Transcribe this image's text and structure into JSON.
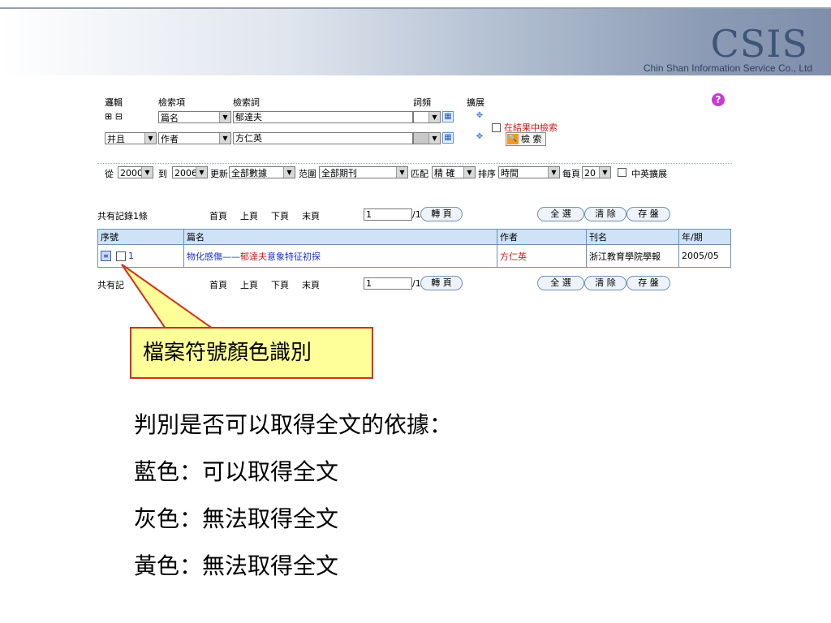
{
  "header": {
    "brand": "CSIS",
    "brand_sub": "Chin Shan Information Service Co., Ltd"
  },
  "search_form": {
    "labels": {
      "logic": "邏輯",
      "field": "檢索項",
      "term": "檢索詞",
      "freq": "詞頻",
      "expand": "擴展"
    },
    "expand_icons": "⊞ ⊟",
    "rows": [
      {
        "logic": "",
        "field": "篇名",
        "term": "郁達夫",
        "freq": ""
      },
      {
        "logic": "并且",
        "field": "作者",
        "term": "方仁英",
        "freq": ""
      }
    ],
    "search_in_results": "在結果中檢索",
    "search_button": "檢 索",
    "options": {
      "from_label": "從",
      "from_year": "2000",
      "to_label": "到",
      "to_year": "2006",
      "update_label": "更新",
      "update_value": "全部數據",
      "scope_label": "范圍",
      "scope_value": "全部期刊",
      "match_label": "匹配",
      "match_value": "精 確",
      "sort_label": "排序",
      "sort_value": "時間",
      "perpage_label": "每頁",
      "perpage_value": "20",
      "cn_en_expand": "中英擴展"
    }
  },
  "pager": {
    "total": "共有記錄1條",
    "first": "首頁",
    "prev": "上頁",
    "next": "下頁",
    "last": "末頁",
    "page_value": "1",
    "page_total": "/1",
    "go_button": "轉 頁",
    "select_all": "全 選",
    "clear": "清 除",
    "save": "存 盤"
  },
  "table": {
    "headers": [
      "序號",
      "篇名",
      "作者",
      "刊名",
      "年/期"
    ],
    "rows": [
      {
        "index": "1",
        "title_a": "物化感傷——",
        "title_b": "郁達夫",
        "title_c": "意象特征初探",
        "author": "方仁英",
        "journal": "浙江教育學院學報",
        "issue": "2005/05"
      }
    ],
    "bottom_total_visible": "共有記"
  },
  "callout": "檔案符號顏色識別",
  "body": {
    "line1": "判別是否可以取得全文的依據：",
    "line2": "藍色：可以取得全文",
    "line3": "灰色：無法取得全文",
    "line4": "黃色：無法取得全文"
  }
}
